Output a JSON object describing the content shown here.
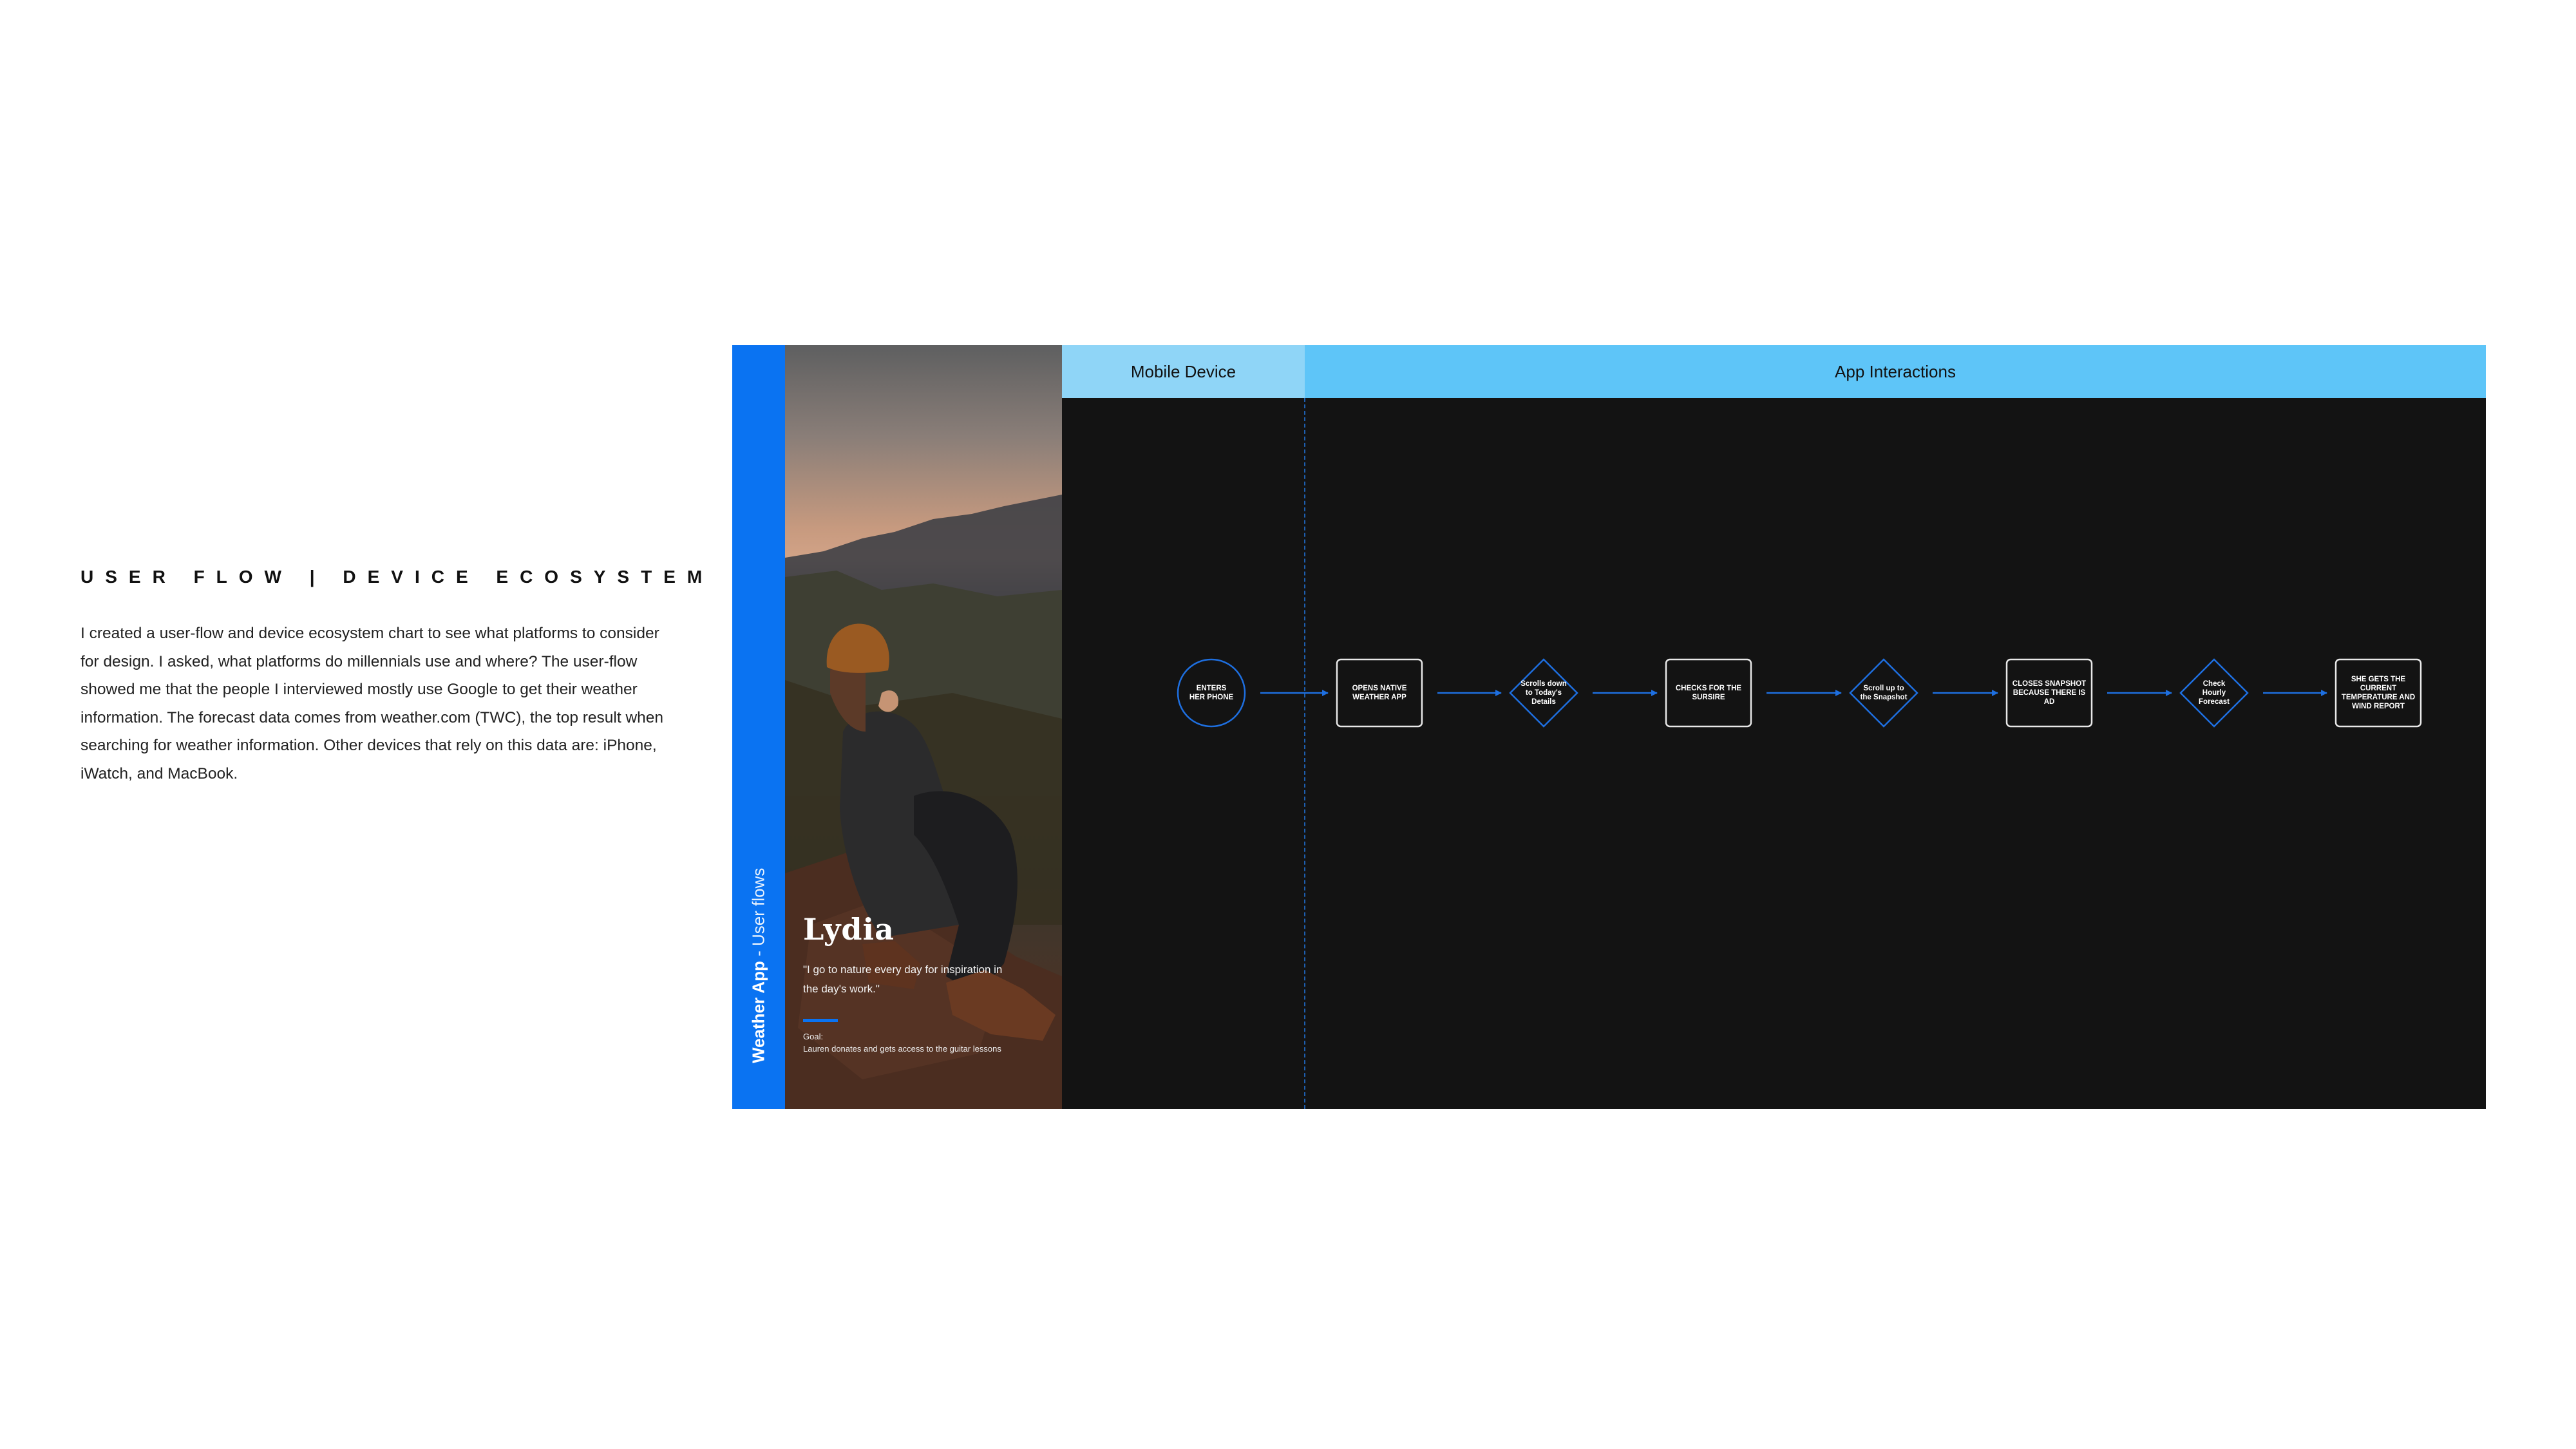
{
  "intro": {
    "heading": "USER FLOW | DEVICE ECOSYSTEM",
    "body": "I created a user-flow and device ecosystem chart to see what platforms to consider for design. I asked, what platforms do millennials use and where? The user-flow showed me that the people I interviewed mostly use Google to get their weather information. The forecast data comes from weather.com (TWC), the top result when searching for weather information. Other devices that rely on this data are: iPhone, iWatch, and MacBook."
  },
  "board": {
    "side_label_app": "Weather App",
    "side_label_sep": " - ",
    "side_label_flows": "User flows",
    "persona": {
      "name": "Lydia",
      "quote": "\"I go to nature every day for inspiration in the day's work.\"",
      "goal_label": "Goal:",
      "goal_text": "Lauren donates and gets access to the guitar lessons"
    },
    "lanes": {
      "mobile": "Mobile Device",
      "app": "App Interactions"
    },
    "steps": [
      {
        "shape": "circle",
        "label": "ENTERS HER PHONE"
      },
      {
        "shape": "box",
        "label": "OPENS NATIVE WEATHER APP"
      },
      {
        "shape": "diamond",
        "label": "Scrolls down to Today's Details"
      },
      {
        "shape": "box",
        "label": "CHECKS FOR THE SURSIRE"
      },
      {
        "shape": "diamond",
        "label": "Scroll up to the Snapshot"
      },
      {
        "shape": "box",
        "label": "CLOSES SNAPSHOT BECAUSE THERE IS AD"
      },
      {
        "shape": "diamond",
        "label": "Check Hourly Forecast"
      },
      {
        "shape": "box",
        "label": "SHE GETS THE CURRENT TEMPERATURE AND WIND REPORT"
      }
    ]
  },
  "colors": {
    "accent_blue": "#0a73f2",
    "lane_mobile": "#8fd5f7",
    "lane_app": "#5ec5f8",
    "board_bg": "#131313",
    "connector": "#1e6fe0"
  }
}
